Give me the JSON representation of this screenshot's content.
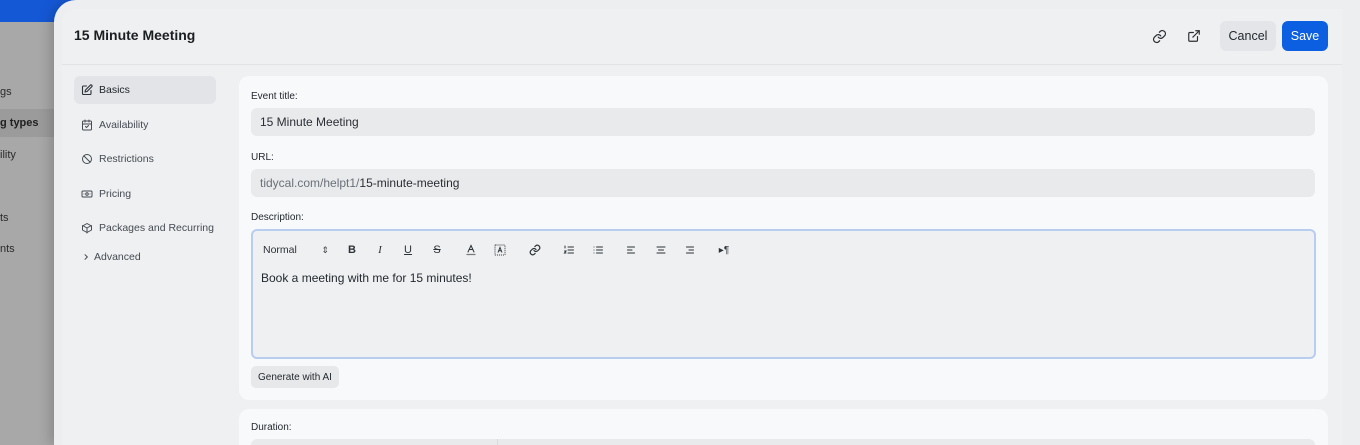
{
  "background_nav": {
    "items": [
      {
        "label": "gs"
      },
      {
        "label": "g types"
      },
      {
        "label": "ility"
      },
      {
        "label": "ts"
      },
      {
        "label": "nts"
      }
    ]
  },
  "header": {
    "title": "15 Minute Meeting",
    "icons": [
      "link-icon",
      "external-link-icon"
    ],
    "cancel_label": "Cancel",
    "save_label": "Save"
  },
  "sidemenu": {
    "items": [
      {
        "label": "Basics",
        "icon": "edit-icon",
        "active": true
      },
      {
        "label": "Availability",
        "icon": "calendar-icon",
        "active": false
      },
      {
        "label": "Restrictions",
        "icon": "ban-icon",
        "active": false
      },
      {
        "label": "Pricing",
        "icon": "money-icon",
        "active": false
      },
      {
        "label": "Packages and Recurring",
        "icon": "package-icon",
        "active": false
      }
    ],
    "advanced_label": "Advanced"
  },
  "form": {
    "event_title_label": "Event title:",
    "event_title_value": "15 Minute Meeting",
    "url_label": "URL:",
    "url_prefix": "tidycal.com/helpt1/",
    "url_slug": "15-minute-meeting",
    "description_label": "Description:",
    "format_select_value": "Normal",
    "description_text": "Book a meeting with me for 15 minutes!",
    "generate_ai_label": "Generate with AI",
    "duration_label": "Duration:"
  },
  "colors": {
    "accent": "#0b5fe0",
    "top_bar": "#1558d6",
    "editor_focus_border": "#b9cdf0"
  }
}
